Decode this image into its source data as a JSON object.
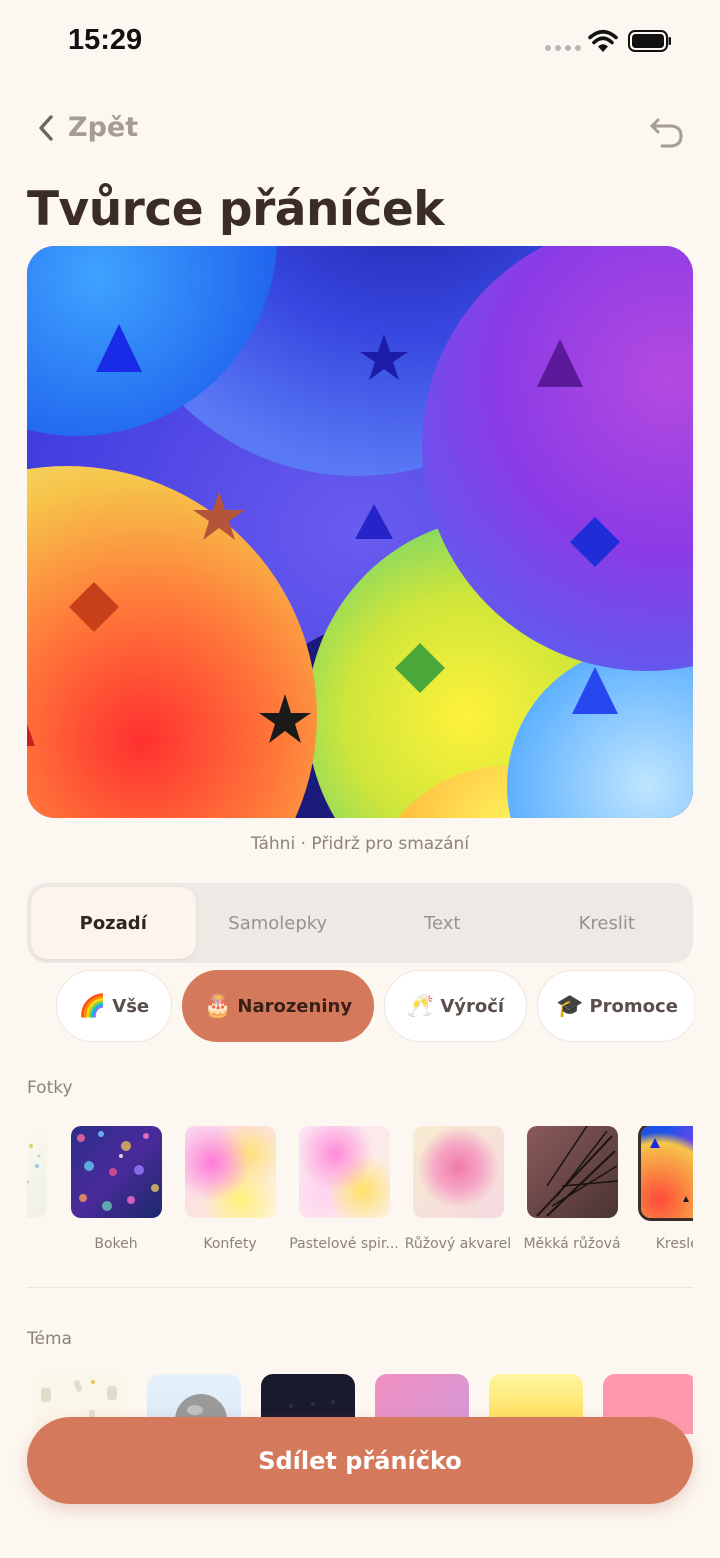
{
  "status_bar": {
    "time": "15:29"
  },
  "nav": {
    "back_label": "Zpět"
  },
  "page": {
    "title": "Tvůrce přáníček"
  },
  "canvas": {
    "hint": "Táhni · Přidrž pro smazání"
  },
  "tabs": [
    {
      "label": "Pozadí",
      "active": true
    },
    {
      "label": "Samolepky",
      "active": false
    },
    {
      "label": "Text",
      "active": false
    },
    {
      "label": "Kreslit",
      "active": false
    }
  ],
  "categories": [
    {
      "emoji": "🌈",
      "label": "Vše",
      "active": false
    },
    {
      "emoji": "🎂",
      "label": "Narozeniny",
      "active": true
    },
    {
      "emoji": "🥂",
      "label": "Výročí",
      "active": false
    },
    {
      "emoji": "🎓",
      "label": "Promoce",
      "active": false
    }
  ],
  "photos": {
    "section_label": "Fotky",
    "items": [
      {
        "caption": "Bokeh"
      },
      {
        "caption": "Konfety"
      },
      {
        "caption": "Pastelové spir..."
      },
      {
        "caption": "Růžový akvarel"
      },
      {
        "caption": "Měkká růžová"
      },
      {
        "caption": "Kreslené"
      }
    ]
  },
  "theme": {
    "section_label": "Téma"
  },
  "share_button": {
    "label": "Sdílet přáníčko"
  },
  "colors": {
    "accent": "#d4795b",
    "background": "#fdf7f2",
    "text": "#3b2c28"
  }
}
